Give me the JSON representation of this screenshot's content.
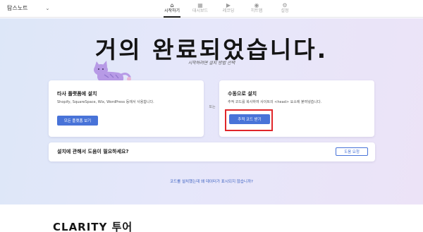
{
  "header": {
    "project_name": "탐스노트",
    "nav": [
      {
        "label": "시작하기",
        "icon": "home-icon",
        "glyph": "⌂"
      },
      {
        "label": "대시보드",
        "icon": "dashboard-icon",
        "glyph": "▦"
      },
      {
        "label": "레코딩",
        "icon": "recording-icon",
        "glyph": "▶"
      },
      {
        "label": "히트맵",
        "icon": "heatmap-icon",
        "glyph": "◉"
      },
      {
        "label": "설정",
        "icon": "gear-icon",
        "glyph": "⚙"
      }
    ]
  },
  "hero": {
    "headline": "거의 완료되었습니다.",
    "subheadline": "시작하려면 설치 방법 선택"
  },
  "install_cards": {
    "integration": {
      "title": "타사 플랫폼에 설치",
      "description": "Shopify, SquareSpace, Wix, WordPress 등에서 사용합니다.",
      "button": "모든 플랫폼 보기"
    },
    "separator": "또는",
    "manual": {
      "title": "수동으로 설치",
      "description": "추적 코드를 복사하여 사이트의 <head> 요소에 붙여넣습니다.",
      "button": "추적 코드 받기"
    }
  },
  "help_banner": {
    "text": "설치에 관해서 도움이 필요하세요?",
    "button": "도움 요청"
  },
  "footer_link": "코드를 설치했는데 왜 데이터가 표시되지 않습니까?",
  "tour_title": "CLARITY 투어",
  "colors": {
    "accent": "#4873d8",
    "highlight_box": "#e0262a"
  }
}
